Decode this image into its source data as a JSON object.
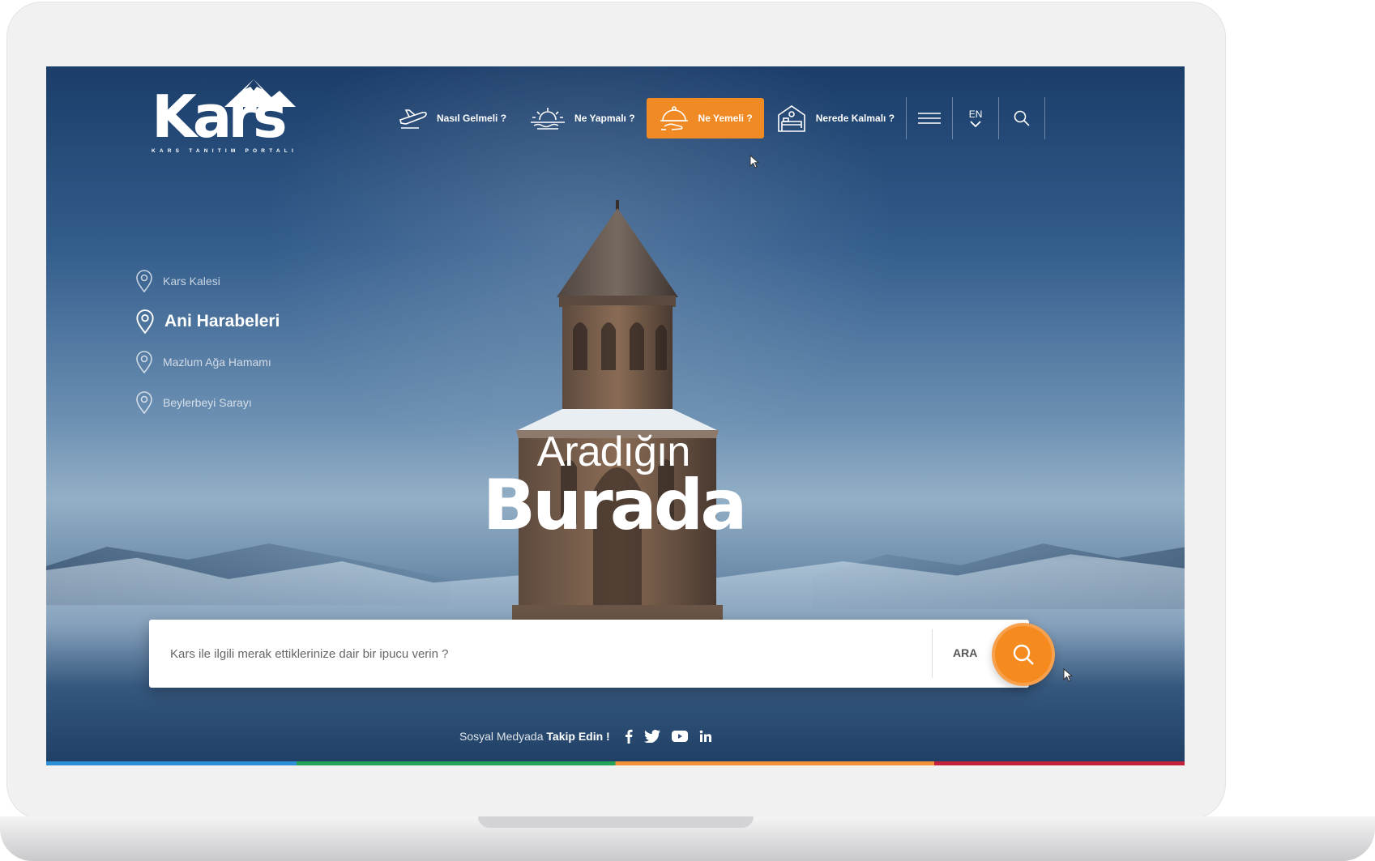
{
  "logo": {
    "name": "Kars",
    "tagline": "KARS TANITIM PORTALI"
  },
  "nav": {
    "items": [
      {
        "label": "Nasıl Gelmeli ?",
        "icon": "airplane-icon",
        "active": false
      },
      {
        "label": "Ne Yapmalı ?",
        "icon": "sunset-icon",
        "active": false
      },
      {
        "label": "Ne Yemeli ?",
        "icon": "food-cloche-icon",
        "active": true
      },
      {
        "label": "Nerede Kalmalı ?",
        "icon": "hotel-bed-icon",
        "active": false
      }
    ],
    "language": "EN",
    "accent_color": "#f08a25"
  },
  "locations": [
    {
      "label": "Kars Kalesi",
      "active": false
    },
    {
      "label": "Ani Harabeleri",
      "active": true
    },
    {
      "label": "Mazlum Ağa Hamamı",
      "active": false
    },
    {
      "label": "Beylerbeyi Sarayı",
      "active": false
    }
  ],
  "hero": {
    "line1": "Aradığın",
    "line2": "Burada"
  },
  "search": {
    "placeholder": "Kars ile ilgili merak ettiklerinize dair bir ipucu verin ?",
    "button_label": "ARA"
  },
  "social": {
    "prefix": "Sosyal Medyada",
    "cta": "Takip Edin !",
    "networks": [
      "facebook-icon",
      "twitter-icon",
      "youtube-icon",
      "linkedin-icon"
    ]
  }
}
